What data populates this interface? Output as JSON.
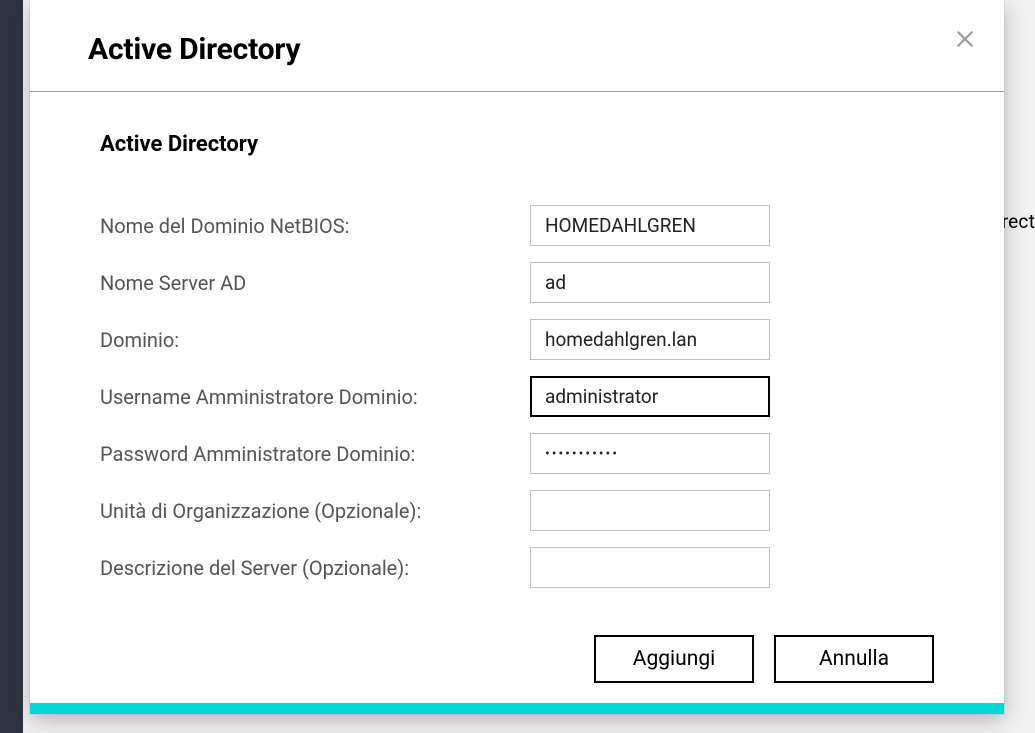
{
  "background": {
    "partialText": "irect"
  },
  "modal": {
    "title": "Active Directory",
    "sectionTitle": "Active Directory",
    "fields": {
      "netbios": {
        "label": "Nome del Dominio NetBIOS:",
        "value": "HOMEDAHLGREN"
      },
      "adserver": {
        "label": "Nome Server AD",
        "value": "ad"
      },
      "domain": {
        "label": "Dominio:",
        "value": "homedahlgren.lan"
      },
      "adminuser": {
        "label": "Username Amministratore Dominio:",
        "value": "administrator"
      },
      "adminpass": {
        "label": "Password Amministratore Dominio:",
        "value": "•••••••••••"
      },
      "orgunit": {
        "label": "Unità di Organizzazione (Opzionale):",
        "value": ""
      },
      "serverdesc": {
        "label": "Descrizione del Server (Opzionale):",
        "value": ""
      }
    },
    "buttons": {
      "add": "Aggiungi",
      "cancel": "Annulla"
    }
  }
}
